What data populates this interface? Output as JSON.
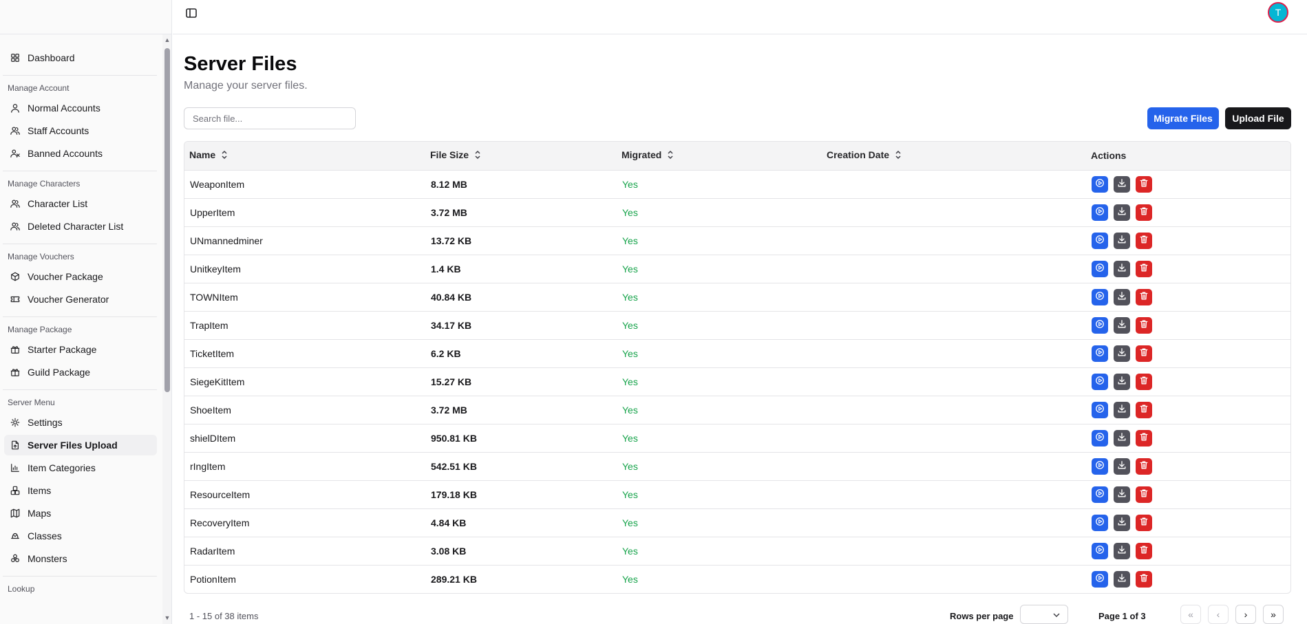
{
  "sidebar": {
    "items": [
      {
        "type": "item",
        "label": "Dashboard",
        "icon": "dashboard-icon"
      },
      {
        "type": "section",
        "label": "Manage Account"
      },
      {
        "type": "item",
        "label": "Normal Accounts",
        "icon": "user-icon"
      },
      {
        "type": "item",
        "label": "Staff Accounts",
        "icon": "users-icon"
      },
      {
        "type": "item",
        "label": "Banned Accounts",
        "icon": "user-x-icon"
      },
      {
        "type": "section",
        "label": "Manage Characters"
      },
      {
        "type": "item",
        "label": "Character List",
        "icon": "users-icon"
      },
      {
        "type": "item",
        "label": "Deleted Character List",
        "icon": "users-icon"
      },
      {
        "type": "section",
        "label": "Manage Vouchers"
      },
      {
        "type": "item",
        "label": "Voucher Package",
        "icon": "package-icon"
      },
      {
        "type": "item",
        "label": "Voucher Generator",
        "icon": "ticket-icon"
      },
      {
        "type": "section",
        "label": "Manage Package"
      },
      {
        "type": "item",
        "label": "Starter Package",
        "icon": "gift-icon"
      },
      {
        "type": "item",
        "label": "Guild Package",
        "icon": "gift-icon"
      },
      {
        "type": "section",
        "label": "Server Menu"
      },
      {
        "type": "item",
        "label": "Settings",
        "icon": "gear-icon"
      },
      {
        "type": "item",
        "label": "Server Files Upload",
        "icon": "file-upload-icon",
        "active": true
      },
      {
        "type": "item",
        "label": "Item Categories",
        "icon": "chart-icon"
      },
      {
        "type": "item",
        "label": "Items",
        "icon": "boxes-icon"
      },
      {
        "type": "item",
        "label": "Maps",
        "icon": "map-icon"
      },
      {
        "type": "item",
        "label": "Classes",
        "icon": "hat-icon"
      },
      {
        "type": "item",
        "label": "Monsters",
        "icon": "biohazard-icon"
      },
      {
        "type": "section",
        "label": "Lookup"
      }
    ]
  },
  "topbar": {
    "avatar_initial": "T"
  },
  "page": {
    "title": "Server Files",
    "subtitle": "Manage your server files."
  },
  "search": {
    "placeholder": "Search file...",
    "value": ""
  },
  "buttons": {
    "migrate": "Migrate Files",
    "upload": "Upload File"
  },
  "table": {
    "columns": [
      "Name",
      "File Size",
      "Migrated",
      "Creation Date",
      "Actions"
    ],
    "rows": [
      {
        "name": "WeaponItem",
        "size": "8.12 MB",
        "migrated": "Yes",
        "date": ""
      },
      {
        "name": "UpperItem",
        "size": "3.72 MB",
        "migrated": "Yes",
        "date": ""
      },
      {
        "name": "UNmannedminer",
        "size": "13.72 KB",
        "migrated": "Yes",
        "date": ""
      },
      {
        "name": "UnitkeyItem",
        "size": "1.4 KB",
        "migrated": "Yes",
        "date": ""
      },
      {
        "name": "TOWNItem",
        "size": "40.84 KB",
        "migrated": "Yes",
        "date": ""
      },
      {
        "name": "TrapItem",
        "size": "34.17 KB",
        "migrated": "Yes",
        "date": ""
      },
      {
        "name": "TicketItem",
        "size": "6.2 KB",
        "migrated": "Yes",
        "date": ""
      },
      {
        "name": "SiegeKitItem",
        "size": "15.27 KB",
        "migrated": "Yes",
        "date": ""
      },
      {
        "name": "ShoeItem",
        "size": "3.72 MB",
        "migrated": "Yes",
        "date": ""
      },
      {
        "name": "shielDItem",
        "size": "950.81 KB",
        "migrated": "Yes",
        "date": ""
      },
      {
        "name": "rIngItem",
        "size": "542.51 KB",
        "migrated": "Yes",
        "date": ""
      },
      {
        "name": "ResourceItem",
        "size": "179.18 KB",
        "migrated": "Yes",
        "date": ""
      },
      {
        "name": "RecoveryItem",
        "size": "4.84 KB",
        "migrated": "Yes",
        "date": ""
      },
      {
        "name": "RadarItem",
        "size": "3.08 KB",
        "migrated": "Yes",
        "date": ""
      },
      {
        "name": "PotionItem",
        "size": "289.21 KB",
        "migrated": "Yes",
        "date": ""
      }
    ]
  },
  "footer": {
    "count": "1 - 15 of 38 items",
    "rows_per_page_label": "Rows per page",
    "rows_per_page_value": "",
    "page_info": "Page 1 of 3",
    "first": "«",
    "prev": "‹",
    "next": "›",
    "last": "»"
  },
  "colors": {
    "primary": "#2563eb",
    "dark": "#18181b",
    "success": "#16a34a",
    "danger": "#dc2626",
    "muted_button": "#52525b"
  }
}
